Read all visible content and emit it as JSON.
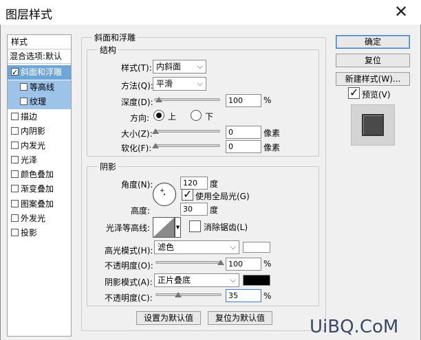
{
  "window": {
    "title": "图层样式",
    "close_glyph": "✕"
  },
  "left_list": {
    "items": [
      {
        "label": "样式",
        "checkbox": false,
        "checked": false,
        "state": "header"
      },
      {
        "label": "混合选项:默认",
        "checkbox": false,
        "checked": false,
        "state": "header"
      },
      {
        "label": "斜面和浮雕",
        "checkbox": true,
        "checked": true,
        "state": "selected"
      },
      {
        "label": "等高线",
        "checkbox": true,
        "checked": false,
        "state": "sub"
      },
      {
        "label": "纹理",
        "checkbox": true,
        "checked": false,
        "state": "sub"
      },
      {
        "label": "描边",
        "checkbox": true,
        "checked": false,
        "state": "normal"
      },
      {
        "label": "内阴影",
        "checkbox": true,
        "checked": false,
        "state": "normal"
      },
      {
        "label": "内发光",
        "checkbox": true,
        "checked": false,
        "state": "normal"
      },
      {
        "label": "光泽",
        "checkbox": true,
        "checked": false,
        "state": "normal"
      },
      {
        "label": "颜色叠加",
        "checkbox": true,
        "checked": false,
        "state": "normal"
      },
      {
        "label": "渐变叠加",
        "checkbox": true,
        "checked": false,
        "state": "normal"
      },
      {
        "label": "图案叠加",
        "checkbox": true,
        "checked": false,
        "state": "normal"
      },
      {
        "label": "外发光",
        "checkbox": true,
        "checked": false,
        "state": "normal"
      },
      {
        "label": "投影",
        "checkbox": true,
        "checked": false,
        "state": "normal"
      }
    ]
  },
  "bevel": {
    "group_title": "斜面和浮雕",
    "structure": {
      "title": "结构",
      "style_label": "样式(T):",
      "style_value": "内斜面",
      "technique_label": "方法(Q):",
      "technique_value": "平滑",
      "depth_label": "深度(D):",
      "depth_value": "100",
      "depth_unit": "%",
      "direction_label": "方向:",
      "direction_up": "上",
      "direction_down": "下",
      "direction_selected": "up",
      "size_label": "大小(Z):",
      "size_value": "0",
      "size_unit": "像素",
      "soften_label": "软化(F):",
      "soften_value": "0",
      "soften_unit": "像素"
    },
    "shading": {
      "title": "阴影",
      "angle_label": "角度(N):",
      "angle_value": "120",
      "angle_unit": "度",
      "global_light_label": "使用全局光(G)",
      "global_light_checked": true,
      "altitude_label": "高度:",
      "altitude_value": "30",
      "altitude_unit": "度",
      "gloss_contour_label": "光泽等高线:",
      "anti_aliased_label": "消除锯齿(L)",
      "anti_aliased_checked": false,
      "highlight_mode_label": "高光模式(H):",
      "highlight_mode_value": "滤色",
      "highlight_color": "#ffffff",
      "highlight_opacity_label": "不透明度(O):",
      "highlight_opacity_value": "100",
      "highlight_opacity_unit": "%",
      "shadow_mode_label": "阴影模式(A):",
      "shadow_mode_value": "正片叠底",
      "shadow_color": "#000000",
      "shadow_opacity_label": "不透明度(C):",
      "shadow_opacity_value": "35",
      "shadow_opacity_unit": "%"
    },
    "make_default_label": "设置为默认值",
    "reset_default_label": "复位为默认值"
  },
  "right_buttons": {
    "ok_label": "确定",
    "reset_label": "复位",
    "new_style_label": "新建样式(W)...",
    "preview_label": "预览(V)",
    "preview_checked": true
  },
  "watermark": "UiBQ.CoM"
}
